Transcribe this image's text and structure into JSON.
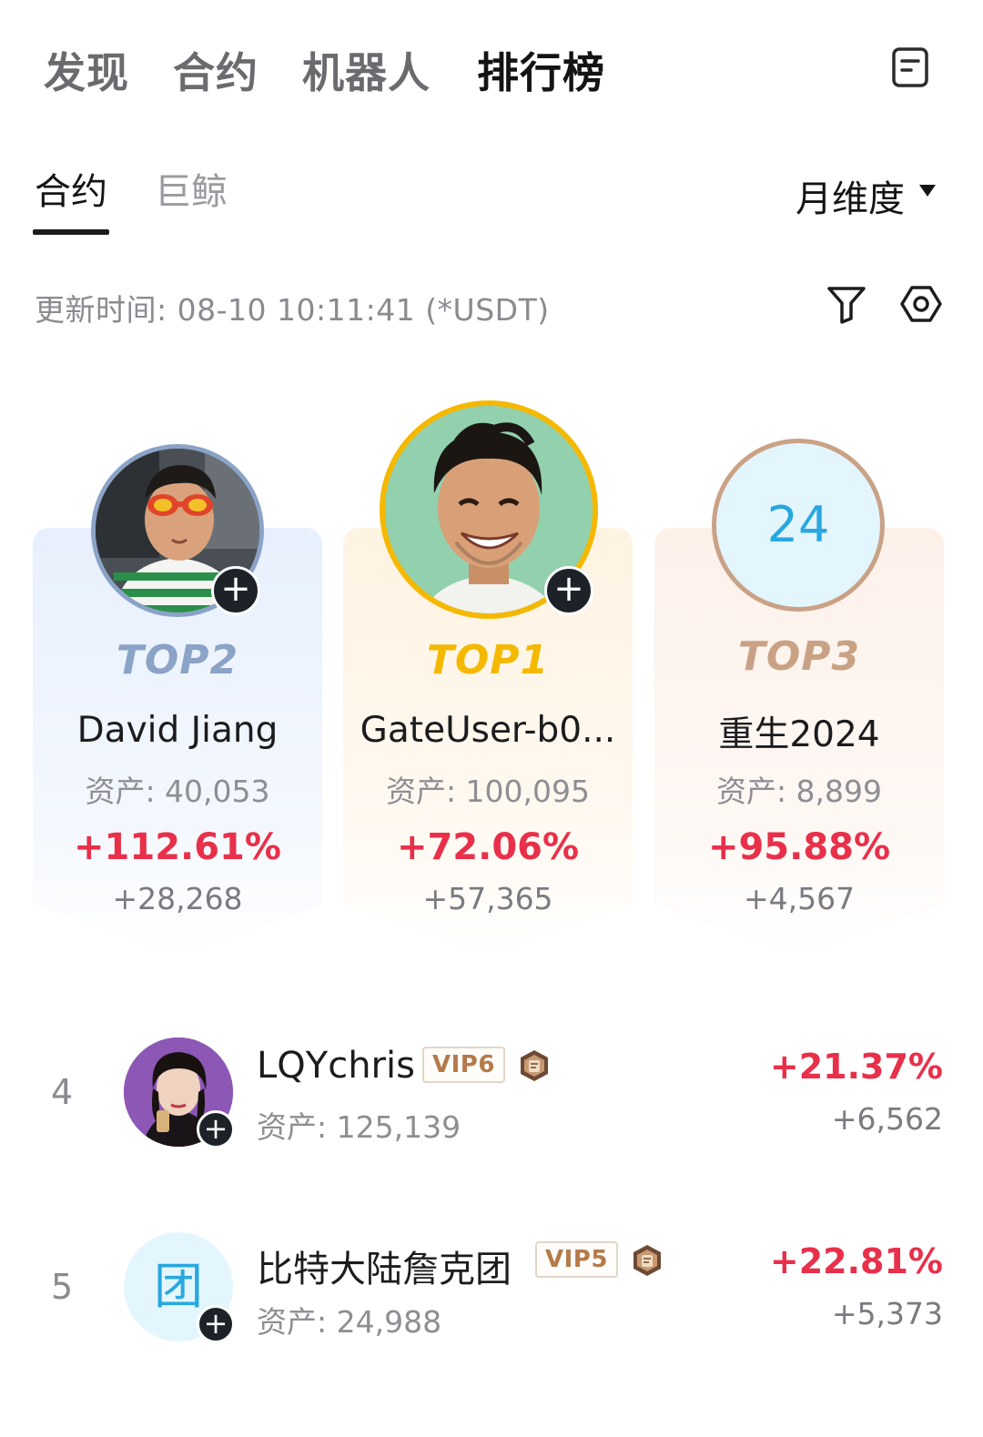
{
  "nav": {
    "tabs": [
      "发现",
      "合约",
      "机器人",
      "排行榜"
    ],
    "active_tab": "排行榜"
  },
  "subtabs": [
    "合约",
    "巨鲸"
  ],
  "period": "月维度",
  "update_time": "更新时间: 08-10 10:11:41 (*USDT)",
  "podium": [
    {
      "rank_label": "TOP2",
      "name": "David Jiang",
      "assets": "资产: 40,053",
      "pct": "+112.61%",
      "pnl": "+28,268",
      "accent": "#8aa3c6"
    },
    {
      "rank_label": "TOP1",
      "name": "GateUser-b0...",
      "assets": "资产: 100,095",
      "pct": "+72.06%",
      "pnl": "+57,365",
      "accent": "#f5b800"
    },
    {
      "rank_label": "TOP3",
      "name": "重生2024",
      "avatar_text": "24",
      "assets": "资产: 8,899",
      "pct": "+95.88%",
      "pnl": "+4,567",
      "accent": "#c9a286"
    }
  ],
  "list": [
    {
      "rank": "4",
      "name": "LQYchris",
      "vip": "VIP6",
      "assets": "资产: 125,139",
      "pct": "+21.37%",
      "pnl": "+6,562"
    },
    {
      "rank": "5",
      "name": "比特大陆詹克团",
      "vip": "VIP5",
      "avatar_text": "团",
      "assets": "资产: 24,988",
      "pct": "+22.81%",
      "pnl": "+5,373"
    }
  ],
  "colors": {
    "positive": "#e8304a",
    "avatar_text": "#29a8e0"
  }
}
